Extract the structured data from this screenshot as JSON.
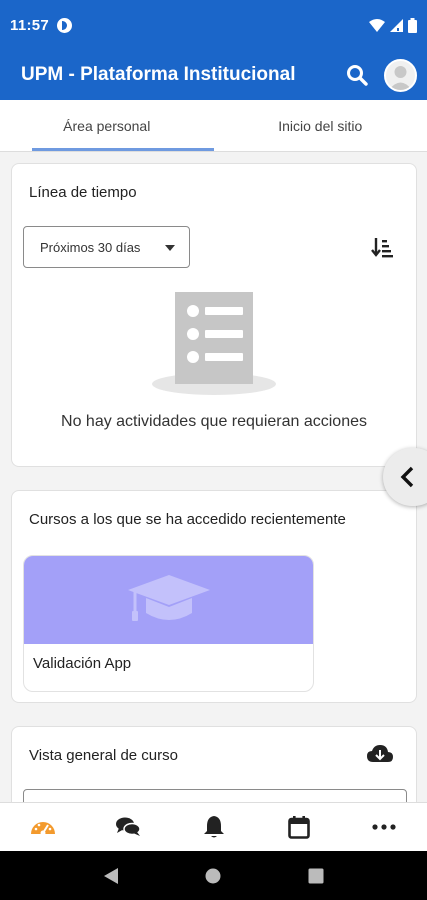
{
  "status": {
    "time": "11:57"
  },
  "appbar": {
    "title": "UPM - Plataforma Institucional"
  },
  "tabs": [
    {
      "label": "Área personal"
    },
    {
      "label": "Inicio del sitio"
    }
  ],
  "timeline": {
    "title": "Línea de tiempo",
    "filter_value": "Próximos 30 días",
    "empty_message": "No hay actividades que requieran acciones"
  },
  "recent": {
    "title": "Cursos a los que se ha accedido recientemente",
    "courses": [
      {
        "name": "Validación App",
        "banner_color": "#a3a0f8"
      }
    ]
  },
  "overview": {
    "title": "Vista general de curso"
  },
  "colors": {
    "primary": "#1b66c9",
    "active_nav": "#f39a2d"
  },
  "bottom_nav": [
    {
      "icon": "dashboard-icon"
    },
    {
      "icon": "messages-icon"
    },
    {
      "icon": "bell-icon"
    },
    {
      "icon": "calendar-icon"
    },
    {
      "icon": "more-icon"
    }
  ]
}
